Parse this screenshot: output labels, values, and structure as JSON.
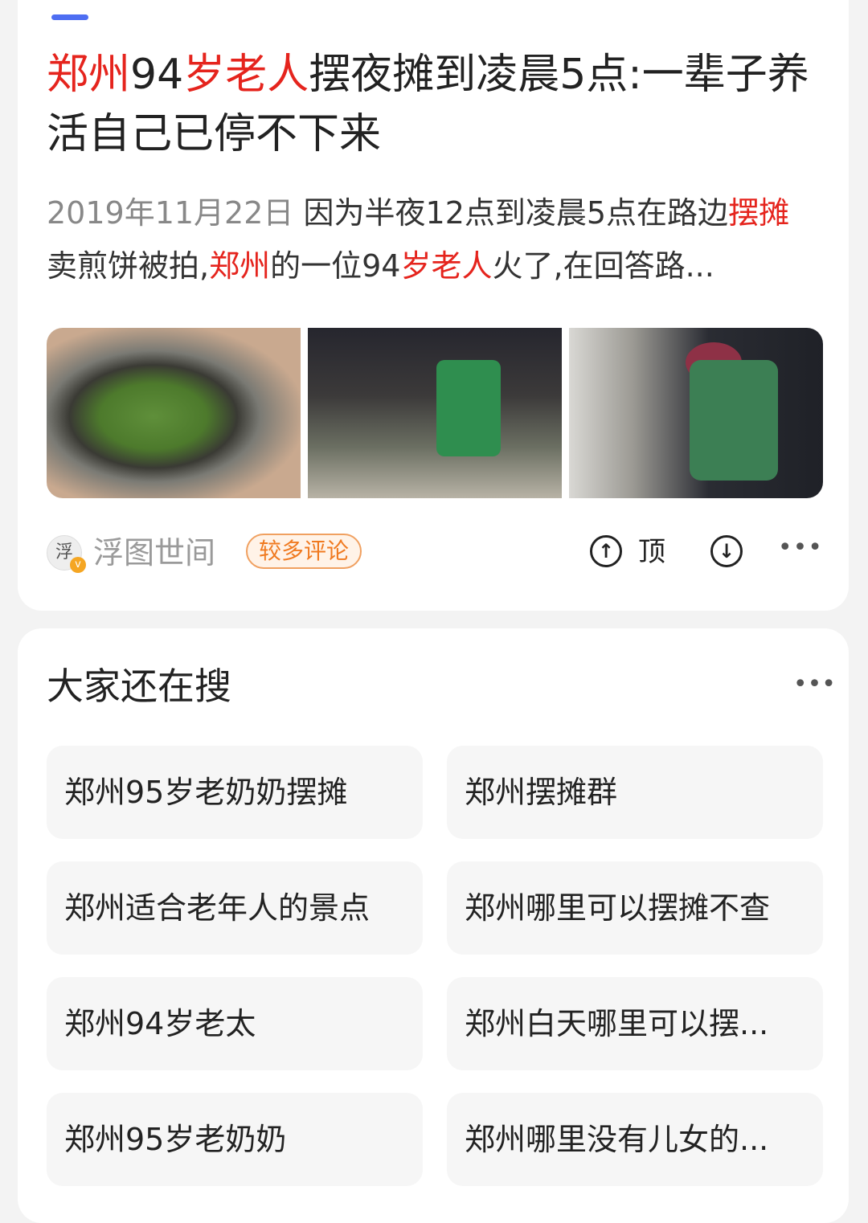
{
  "result": {
    "title_parts": [
      {
        "text": "郑州",
        "hl": true
      },
      {
        "text": "94",
        "hl": false
      },
      {
        "text": "岁老人",
        "hl": true
      },
      {
        "text": "摆夜摊到凌晨5点:一辈子养活自己已停不下来",
        "hl": false
      }
    ],
    "date": "2019年11月22日",
    "summary_parts": [
      {
        "text": "因为半夜12点到凌晨5点在路边",
        "hl": false
      },
      {
        "text": "摆摊",
        "hl": true
      },
      {
        "text": "卖煎饼被拍,",
        "hl": false
      },
      {
        "text": "郑州",
        "hl": true
      },
      {
        "text": "的一位94",
        "hl": false
      },
      {
        "text": "岁老人",
        "hl": true
      },
      {
        "text": "火了,在回答路...",
        "hl": false
      }
    ],
    "images": [
      "green-onion-bowl-photo",
      "elderly-woman-cooking-photo",
      "night-food-stall-photo"
    ],
    "source": {
      "avatar_glyph": "浮",
      "verified_mark": "v",
      "name": "浮图世间",
      "badge": "较多评论"
    },
    "actions": {
      "up_icon": "↑",
      "up_label": "顶",
      "down_icon": "↓",
      "more": "•••"
    }
  },
  "related": {
    "title": "大家还在搜",
    "more": "•••",
    "items": [
      "郑州95岁老奶奶摆摊",
      "郑州摆摊群",
      "郑州适合老年人的景点",
      "郑州哪里可以摆摊不查",
      "郑州94岁老太",
      "郑州白天哪里可以摆...",
      "郑州95岁老奶奶",
      "郑州哪里没有儿女的..."
    ]
  },
  "colors": {
    "highlight": "#e5241d",
    "badge": "#f07a20",
    "indicator": "#4e6ef2"
  }
}
